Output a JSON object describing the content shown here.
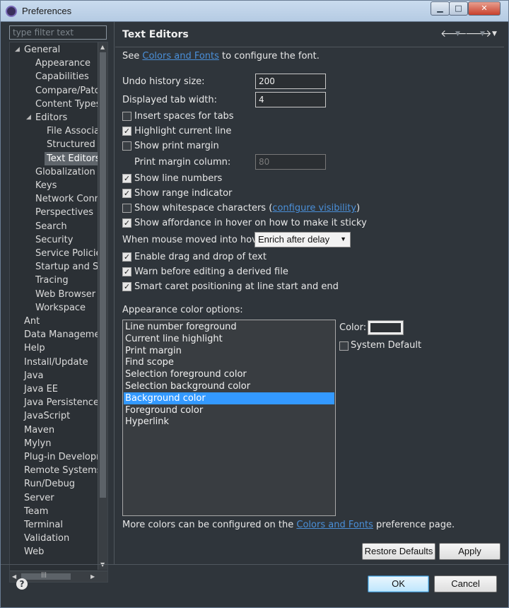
{
  "window": {
    "title": "Preferences",
    "minimize": "▁",
    "maximize": "□",
    "close": "✕"
  },
  "filter": {
    "placeholder": "type filter text"
  },
  "tree": {
    "items": [
      {
        "label": "General",
        "expanded": true
      },
      {
        "label": "Appearance"
      },
      {
        "label": "Capabilities"
      },
      {
        "label": "Compare/Patch"
      },
      {
        "label": "Content Types"
      },
      {
        "label": "Editors",
        "expanded": true
      },
      {
        "label": "File Associations"
      },
      {
        "label": "Structured Text Editors"
      },
      {
        "label": "Text Editors",
        "selected": true
      },
      {
        "label": "Globalization"
      },
      {
        "label": "Keys"
      },
      {
        "label": "Network Connections"
      },
      {
        "label": "Perspectives"
      },
      {
        "label": "Search"
      },
      {
        "label": "Security"
      },
      {
        "label": "Service Policies"
      },
      {
        "label": "Startup and Shutdown"
      },
      {
        "label": "Tracing"
      },
      {
        "label": "Web Browser"
      },
      {
        "label": "Workspace"
      },
      {
        "label": "Ant"
      },
      {
        "label": "Data Management"
      },
      {
        "label": "Help"
      },
      {
        "label": "Install/Update"
      },
      {
        "label": "Java"
      },
      {
        "label": "Java EE"
      },
      {
        "label": "Java Persistence"
      },
      {
        "label": "JavaScript"
      },
      {
        "label": "Maven"
      },
      {
        "label": "Mylyn"
      },
      {
        "label": "Plug-in Development"
      },
      {
        "label": "Remote Systems"
      },
      {
        "label": "Run/Debug"
      },
      {
        "label": "Server"
      },
      {
        "label": "Team"
      },
      {
        "label": "Terminal"
      },
      {
        "label": "Validation"
      },
      {
        "label": "Web"
      }
    ],
    "scroll_up": "▲",
    "scroll_down": "▼",
    "scroll_left": "◀",
    "scroll_right": "▶",
    "hthumb_grip": "|||"
  },
  "page": {
    "title": "Text Editors",
    "nav_back": "🡐",
    "nav_forward": "🡒",
    "nav_menu": "▼",
    "see_prefix": "See ",
    "see_link": "Colors and Fonts",
    "see_suffix": " to configure the font.",
    "undo_label": "Undo history size:",
    "undo_value": "200",
    "tab_label": "Displayed tab width:",
    "tab_value": "4",
    "insert_spaces": "Insert spaces for tabs",
    "highlight_line": "Highlight current line",
    "show_print_margin": "Show print margin",
    "print_margin_label": "Print margin column:",
    "print_margin_value": "80",
    "show_line_numbers": "Show line numbers",
    "show_range": "Show range indicator",
    "show_whitespace_prefix": "Show whitespace characters (",
    "configure_visibility": "configure visibility",
    "show_whitespace_suffix": ")",
    "show_affordance": "Show affordance in hover on how to make it sticky",
    "hover_label": "When mouse moved into hover:",
    "hover_value": "Enrich after delay",
    "drag_drop": "Enable drag and drop of text",
    "warn_derived": "Warn before editing a derived file",
    "smart_caret": "Smart caret positioning at line start and end",
    "appearance_label": "Appearance color options:",
    "color_label": "Color:",
    "system_default": "System Default",
    "more_colors_prefix": "More colors can be configured on the ",
    "more_colors_link": "Colors and Fonts",
    "more_colors_suffix": " preference page.",
    "restore_defaults": "Restore Defaults",
    "apply": "Apply"
  },
  "checks": {
    "insert_spaces": false,
    "highlight_line": true,
    "show_print_margin": false,
    "show_line_numbers": true,
    "show_range": true,
    "show_whitespace": false,
    "show_affordance": true,
    "drag_drop": true,
    "warn_derived": true,
    "smart_caret": true,
    "system_default": false
  },
  "color_options": [
    "Line number foreground",
    "Current line highlight",
    "Print margin",
    "Find scope",
    "Selection foreground color",
    "Selection background color",
    "Background color",
    "Foreground color",
    "Hyperlink"
  ],
  "selected_color_option": "Background color",
  "footer": {
    "help": "?",
    "ok": "OK",
    "cancel": "Cancel"
  }
}
